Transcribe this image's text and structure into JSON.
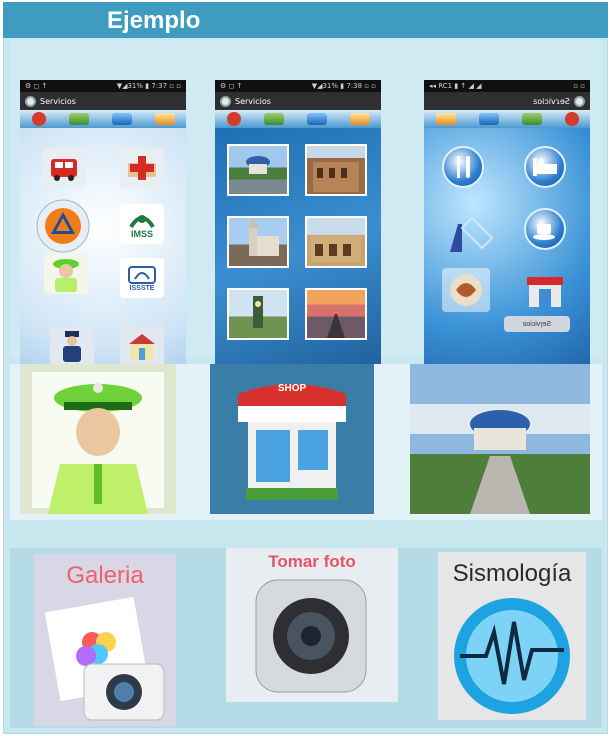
{
  "header": {
    "title": "Ejemplo"
  },
  "phones": [
    {
      "status_left": "⚙ ◻ ↑",
      "status_right": "▼◢31% ▮ 7:37 ▫ ▫",
      "app_title": "Servicios",
      "tiles": [
        {
          "icon": "fire-truck-icon"
        },
        {
          "icon": "red-cross-icon"
        },
        {
          "icon": "civil-protection-icon"
        },
        {
          "icon": "imss-icon",
          "label": "IMSS"
        },
        {
          "icon": "police-officer-icon"
        },
        {
          "icon": "issste-icon",
          "label": "ISSSTE"
        },
        {
          "icon": "guard-icon"
        },
        {
          "icon": "hospital-icon"
        }
      ]
    },
    {
      "status_left": "⚙ ◻ ↑",
      "status_right": "▼◢31% ▮ 7:38 ▫ ▫",
      "app_title": "Servicios",
      "photos": [
        "gazebo-photo",
        "colonial-building-photo",
        "church-photo",
        "arcade-building-photo",
        "clock-tower-photo",
        "sunset-road-photo"
      ]
    },
    {
      "status_left": "◂◂ RC1 ▮ ↑ ◢ ◢",
      "status_right": "▫ ▫",
      "app_title": "soiɔivɿɘƧ",
      "icons": [
        "restaurant-icon",
        "hotel-icon",
        "bar-icon",
        "coffee-icon",
        "food-icon",
        "shop-icon"
      ],
      "footer_label": "soiɔivɿɘƧ"
    }
  ],
  "big_images": [
    "police-officer-illustration",
    "shop-storefront-illustration",
    "gazebo-park-photo"
  ],
  "apps": [
    {
      "label": "Galeria",
      "icon": "gallery-camera-icon",
      "color": "#f0606a"
    },
    {
      "label": "Tomar foto",
      "icon": "camera-icon",
      "color": "#e8555f"
    },
    {
      "label": "Sismología",
      "icon": "seismograph-icon",
      "color": "#2a2a2a"
    }
  ]
}
